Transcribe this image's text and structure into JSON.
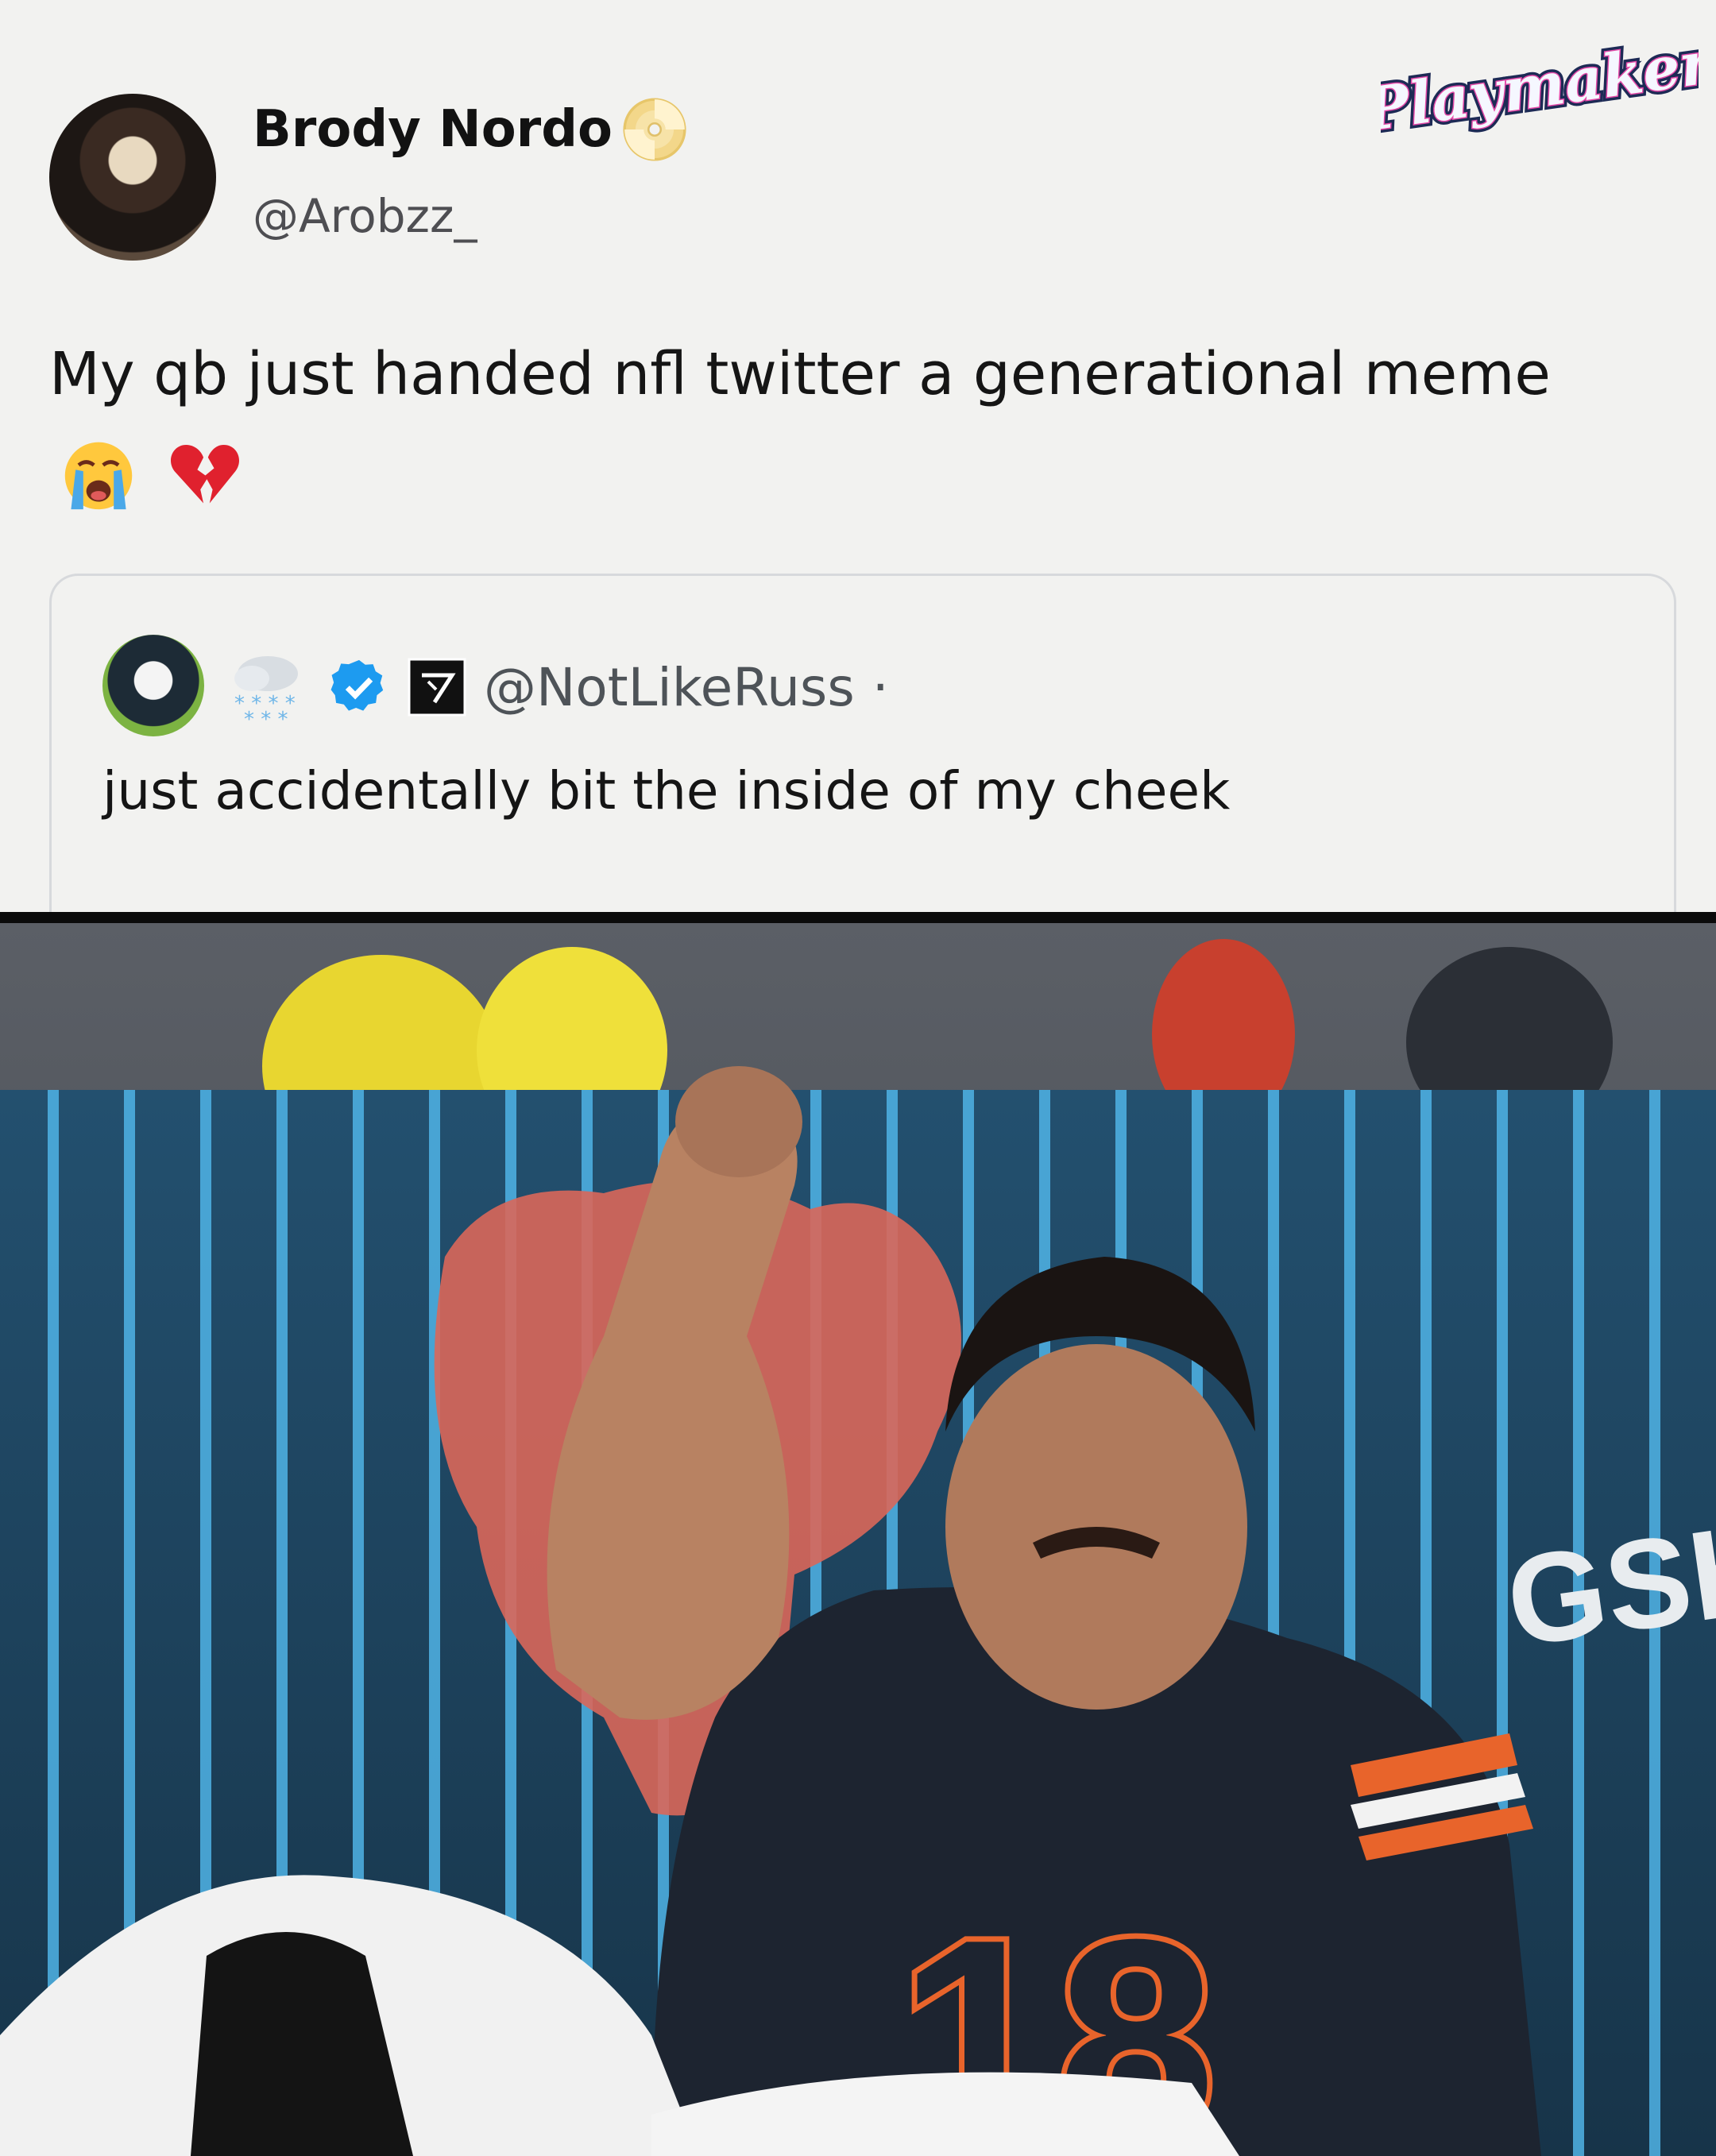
{
  "tweet": {
    "display_name": "Brody Nordo",
    "handle": "@Arobzz_",
    "text": "My qb just handed nfl twitter a generational meme",
    "emojis": [
      "loudly-crying-face",
      "broken-heart"
    ]
  },
  "quoted_tweet": {
    "handle": "@NotLikeRuss",
    "separator": "·",
    "text": "just accidentally bit the inside of my cheek",
    "icons": [
      "snow-cloud-icon",
      "verified-badge-icon",
      "affiliate-logo-icon"
    ]
  },
  "brand": {
    "logo_text": "Playmaker"
  },
  "photo": {
    "jersey_number": "18",
    "banner_text": "GSH",
    "colors": {
      "jersey": "#1d2430",
      "fence": "#1f4a6e",
      "stripes": "#4fb3e6",
      "bear_logo": "#d9675a"
    }
  }
}
